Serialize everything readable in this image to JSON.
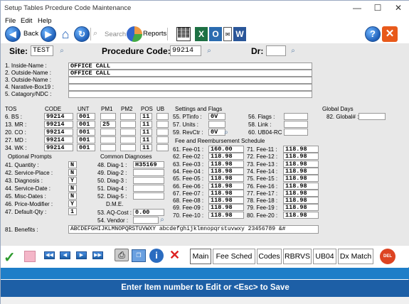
{
  "window": {
    "title": "Setup Tables  Prcedure  Code  Maintenance",
    "min": "—",
    "max": "☐",
    "close": "✕"
  },
  "menu": {
    "file": "File",
    "edit": "Edit",
    "help": "Help"
  },
  "toolbar": {
    "back": "Back",
    "search": "Search",
    "reports": "Reports"
  },
  "fields": {
    "site_label": "Site:",
    "site_value": "TEST",
    "proc_label": "Procedure Code:",
    "proc_value": "99214",
    "dr_label": "Dr:",
    "dr_value": ""
  },
  "names": [
    {
      "label": "1. Inside-Name :",
      "value": "OFFICE CALL"
    },
    {
      "label": "2. Outside-Name :",
      "value": "OFFICE CALL"
    },
    {
      "label": "3. Outside-Name :",
      "value": ""
    },
    {
      "label": "4. Narative-Box19 :",
      "value": ""
    },
    {
      "label": "5. Catagory/NDC :",
      "value": ""
    }
  ],
  "tos": {
    "headers": {
      "tos": "TOS",
      "code": "CODE",
      "unt": "UNT",
      "pm1": "PM1",
      "pm2": "PM2",
      "pos": "POS",
      "ub": "UB"
    },
    "rows": [
      {
        "label": "6. BS :",
        "code": "99214",
        "unt": "001",
        "pm1": "",
        "pm2": "",
        "pos": "11",
        "ub": ""
      },
      {
        "label": "13. MR :",
        "code": "99214",
        "unt": "001",
        "pm1": "25",
        "pm2": "",
        "pos": "11",
        "ub": ""
      },
      {
        "label": "20. CO :",
        "code": "99214",
        "unt": "001",
        "pm1": "",
        "pm2": "",
        "pos": "11",
        "ub": ""
      },
      {
        "label": "27. MD :",
        "code": "99214",
        "unt": "001",
        "pm1": "",
        "pm2": "",
        "pos": "11",
        "ub": ""
      },
      {
        "label": "34. WK :",
        "code": "99214",
        "unt": "001",
        "pm1": "",
        "pm2": "",
        "pos": "11",
        "ub": ""
      }
    ]
  },
  "settings": {
    "title": "Settings and Flags",
    "ptinfo_label": "55. PTinfo :",
    "ptinfo": "0V",
    "units_label": "57. Units :",
    "units": "",
    "revctr_label": "59. RevCtr :",
    "revctr": "0V",
    "flags_label": "56. Flags :",
    "flags": "",
    "link_label": "58. Link :",
    "link": "",
    "ub04rc_label": "60. UB04-RC :",
    "ub04rc": ""
  },
  "global": {
    "title": "Global Days",
    "label": "82. Global# :",
    "value": ""
  },
  "fees": {
    "title": "Fee and Reembursement Schedule",
    "left": [
      {
        "label": "61. Fee-01 :",
        "value": "160.00"
      },
      {
        "label": "62. Fee-02 :",
        "value": "118.98"
      },
      {
        "label": "63. Fee-03 :",
        "value": "118.98"
      },
      {
        "label": "64. Fee-04 :",
        "value": "118.98"
      },
      {
        "label": "65. Fee-05 :",
        "value": "118.98"
      },
      {
        "label": "66. Fee-06 :",
        "value": "118.98"
      },
      {
        "label": "67. Fee-07 :",
        "value": "118.98"
      },
      {
        "label": "68. Fee-08 :",
        "value": "118.98"
      },
      {
        "label": "69. Fee-09 :",
        "value": "118.98"
      },
      {
        "label": "70. Fee-10 :",
        "value": "118.98"
      }
    ],
    "right": [
      {
        "label": "71. Fee-11 :",
        "value": "118.98"
      },
      {
        "label": "72. Fee-12 :",
        "value": "118.98"
      },
      {
        "label": "73. Fee-13 :",
        "value": "118.98"
      },
      {
        "label": "74. Fee-14 :",
        "value": "118.98"
      },
      {
        "label": "75. Fee-15 :",
        "value": "118.98"
      },
      {
        "label": "76. Fee-16 :",
        "value": "118.98"
      },
      {
        "label": "77. Fee-17 :",
        "value": "118.98"
      },
      {
        "label": "78. Fee-18 :",
        "value": "118.98"
      },
      {
        "label": "79. Fee-19 :",
        "value": "118.98"
      },
      {
        "label": "80. Fee-20 :",
        "value": "118.98"
      }
    ]
  },
  "prompts": {
    "title": "Optional Prompts",
    "items": [
      {
        "label": "41. Quantity :",
        "value": "N"
      },
      {
        "label": "42. Service-Place :",
        "value": "N"
      },
      {
        "label": "43. Diagnosis :",
        "value": "Y"
      },
      {
        "label": "44. Service-Date :",
        "value": "N"
      },
      {
        "label": "45. Misc-Dates :",
        "value": "N"
      },
      {
        "label": "46. Price-Modifier :",
        "value": "Y"
      },
      {
        "label": "47. Default-Qty :",
        "value": "1"
      }
    ]
  },
  "diag": {
    "title": "Common Diagnoses",
    "items": [
      {
        "label": "48. Diag-1 :",
        "value": "H35169"
      },
      {
        "label": "49. Diag-2 :",
        "value": ""
      },
      {
        "label": "50. Diag-3 :",
        "value": ""
      },
      {
        "label": "51. Diag-4 :",
        "value": ""
      },
      {
        "label": "52. Diag-5 :",
        "value": ""
      }
    ]
  },
  "dme": {
    "title": "D.M.E.",
    "aq_label": "53. AQ-Cost :",
    "aq_value": "0.00",
    "vendor_label": "54. Vendor :",
    "vendor_value": ""
  },
  "benefits": {
    "label": "81. Benefits :",
    "value": "ABCDEFGHIJKLMNOPQRSTUVWXY abcdefghijklmnopqrstuvwxy 23456789 &#"
  },
  "tabs": [
    "Main",
    "Fee Sched",
    "Codes",
    "RBRVS",
    "UB04",
    "Dx Match"
  ],
  "status": {
    "message": "Enter Item number to Edit or <Esc> to Save"
  },
  "colors": {
    "accent_blue": "#1d5fa6",
    "light_blue": "#1e7ec8",
    "panel": "#e8e8e8"
  }
}
